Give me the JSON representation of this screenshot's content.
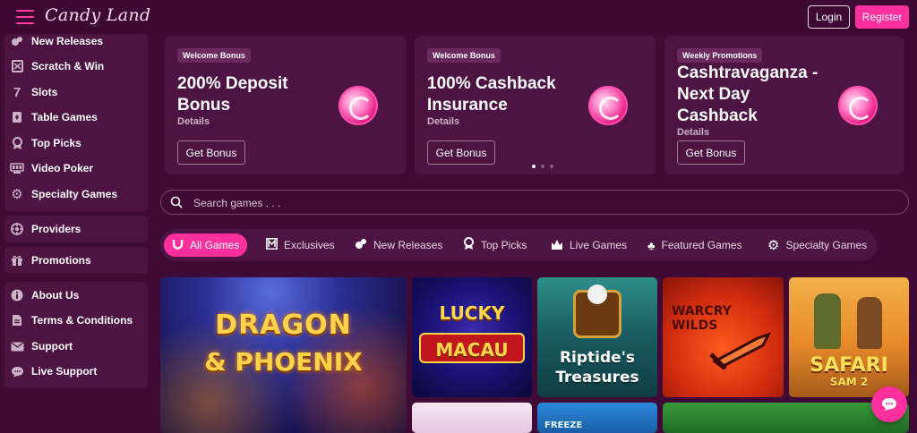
{
  "header": {
    "logo_text": "Candy Land",
    "login_label": "Login",
    "register_label": "Register"
  },
  "sidebar": {
    "main": [
      {
        "icon": "candies-icon",
        "label": "New Releases"
      },
      {
        "icon": "scratch-card-icon",
        "label": "Scratch & Win"
      },
      {
        "icon": "seven-icon",
        "label": "Slots"
      },
      {
        "icon": "card-icon",
        "label": "Table Games"
      },
      {
        "icon": "award-icon",
        "label": "Top Picks"
      },
      {
        "icon": "video-poker-icon",
        "label": "Video Poker"
      },
      {
        "icon": "gear-icon",
        "label": "Specialty Games"
      }
    ],
    "providers": {
      "icon": "providers-icon",
      "label": "Providers"
    },
    "promotions": {
      "icon": "gift-icon",
      "label": "Promotions"
    },
    "info": [
      {
        "icon": "info-icon",
        "label": "About Us"
      },
      {
        "icon": "document-icon",
        "label": "Terms & Conditions"
      },
      {
        "icon": "mail-icon",
        "label": "Support"
      },
      {
        "icon": "chat-icon",
        "label": "Live Support"
      }
    ]
  },
  "promos": [
    {
      "badge": "Welcome Bonus",
      "title": "200% Deposit Bonus",
      "details": "Details",
      "button": "Get Bonus"
    },
    {
      "badge": "Welcome Bonus",
      "title": "100% Cashback Insurance",
      "details": "Details",
      "button": "Get Bonus"
    },
    {
      "badge": "Weekly Promotions",
      "title": "Cashtravaganza - Next Day Cashback",
      "details": "Details",
      "button": "Get Bonus"
    }
  ],
  "search": {
    "placeholder": "Search games . . ."
  },
  "tabs": [
    {
      "icon": "horseshoe-icon",
      "label": "All Games",
      "active": true
    },
    {
      "icon": "exclusive-icon",
      "label": "Exclusives"
    },
    {
      "icon": "candies-icon",
      "label": "New Releases"
    },
    {
      "icon": "award-icon",
      "label": "Top Picks"
    },
    {
      "icon": "live-games-icon",
      "label": "Live Games"
    },
    {
      "icon": "clover-icon",
      "label": "Featured Games"
    },
    {
      "icon": "gear-icon",
      "label": "Specialty Games"
    }
  ],
  "games": [
    {
      "title_line1": "DRAGON",
      "title_line2": "& PHOENIX"
    },
    {
      "title_line1": "LUCKY",
      "title_line2": "MACAU"
    },
    {
      "title_line1": "Riptide's",
      "title_line2": "Treasures"
    },
    {
      "title_line1": "WARCRY",
      "title_line2": "WILDS"
    },
    {
      "title_line1": "SAFARI",
      "title_line2": "SAM 2"
    },
    {
      "title_line1": "FREEZE",
      "title_line2": ""
    }
  ],
  "colors": {
    "background": "#3f0a36",
    "panel": "#4d1343",
    "accent": "#ff2f9e"
  }
}
